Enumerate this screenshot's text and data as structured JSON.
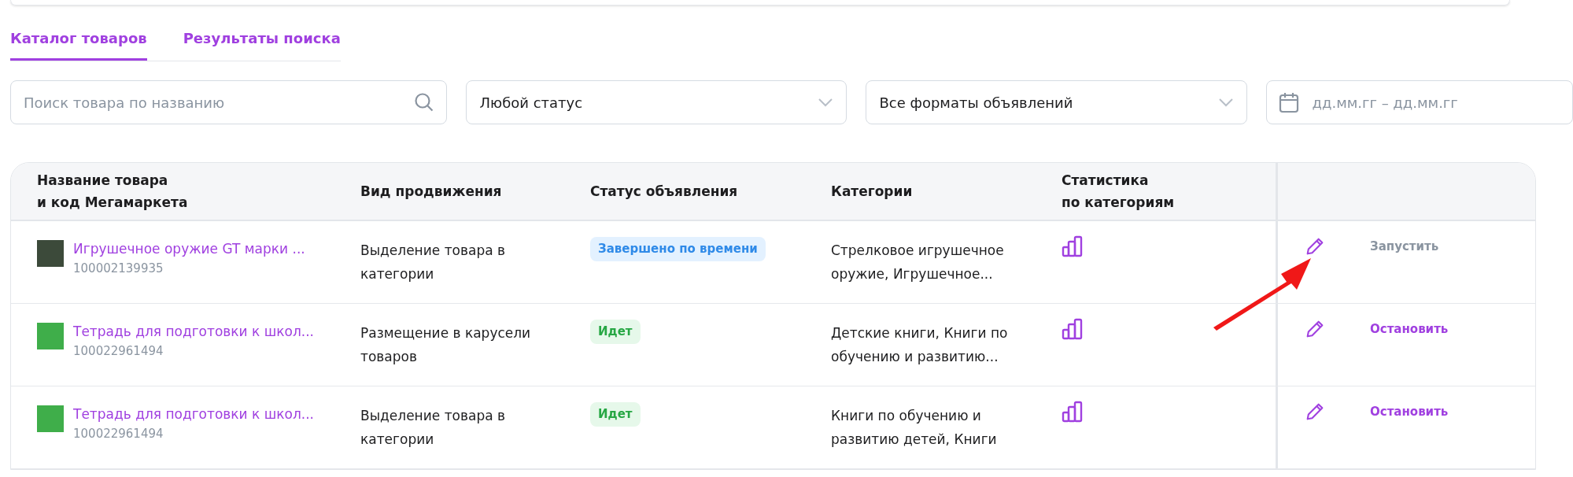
{
  "tabs": [
    {
      "label": "Каталог товаров",
      "selected": true
    },
    {
      "label": "Результаты поиска",
      "selected": false
    }
  ],
  "filters": {
    "search": {
      "placeholder": "Поиск товара по названию"
    },
    "status": {
      "value": "Любой статус"
    },
    "format": {
      "value": "Все форматы объявлений"
    },
    "date": {
      "placeholder": "дд.мм.гг – дд.мм.гг"
    }
  },
  "table": {
    "columns": [
      "Название товара\nи код Мегамаркета",
      "Вид продвижения",
      "Статус объявления",
      "Категории",
      "Статистика\nпо категориям"
    ],
    "rows": [
      {
        "name": "Игрушечное оружие GT марки ...",
        "code": "100002139935",
        "promotion": "Выделение товара в категории",
        "status": {
          "label": "Завершено по времени",
          "kind": "finished"
        },
        "categories": "Стрелковое игрушечное оружие, Игрушечное...",
        "action": {
          "label": "Запустить",
          "disabled": true
        }
      },
      {
        "name": "Тетрадь для подготовки к школ...",
        "code": "100022961494",
        "promotion": "Размещение в карусели товаров",
        "status": {
          "label": "Идет",
          "kind": "running"
        },
        "categories": "Детские книги, Книги по обучению и развитию...",
        "action": {
          "label": "Остановить",
          "disabled": false
        }
      },
      {
        "name": "Тетрадь для подготовки к школ...",
        "code": "100022961494",
        "promotion": "Выделение товара в категории",
        "status": {
          "label": "Идет",
          "kind": "running"
        },
        "categories": "Книги по обучению и развитию детей, Книги",
        "action": {
          "label": "Остановить",
          "disabled": false
        }
      }
    ]
  }
}
